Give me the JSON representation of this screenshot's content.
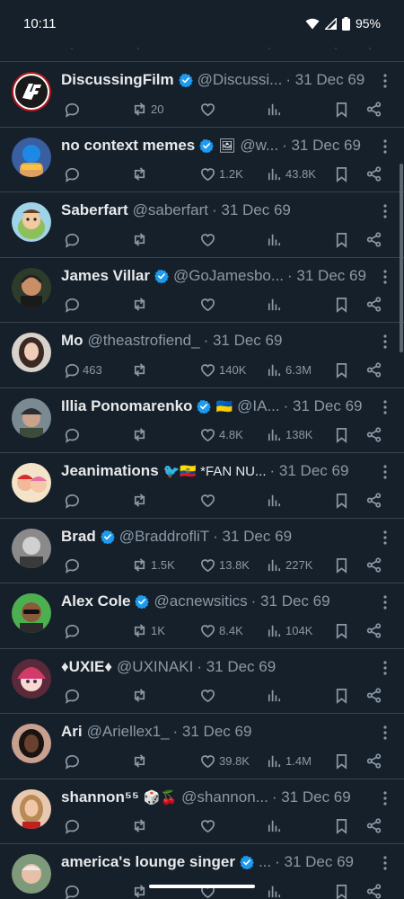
{
  "status_bar": {
    "time": "10:11",
    "battery": "95%"
  },
  "icons": {
    "reply": "reply-icon",
    "retweet": "retweet-icon",
    "like": "like-icon",
    "views": "views-icon",
    "bookmark": "bookmark-icon",
    "share": "share-icon",
    "more": "more-icon",
    "verified": "verified-badge-icon"
  },
  "colors": {
    "background": "#15202b",
    "divider": "#38444d",
    "verified": "#1d9bf0",
    "secondary_text": "#8b98a5"
  },
  "tweets": [
    {
      "name": "DiscussingFilm",
      "verified": true,
      "handle": "@Discussi...",
      "date": "· 31 Dec 69",
      "replies": "",
      "retweets": "20",
      "likes": "",
      "views": "",
      "avatar": "df-logo"
    },
    {
      "name": "no context memes",
      "verified": true,
      "extra": "🖼",
      "handle": "@w...",
      "date": "· 31 Dec 69",
      "replies": "",
      "retweets": "",
      "likes": "1.2K",
      "views": "43.8K",
      "avatar": "wrestler"
    },
    {
      "name": "Saberfart",
      "verified": false,
      "handle": "@saberfart",
      "date": "· 31 Dec 69",
      "replies": "",
      "retweets": "",
      "likes": "",
      "views": "",
      "avatar": "cartoon"
    },
    {
      "name": "James Villar",
      "verified": true,
      "handle": "@GoJamesbo...",
      "date": "· 31 Dec 69",
      "replies": "",
      "retweets": "",
      "likes": "",
      "views": "",
      "avatar": "man-headset"
    },
    {
      "name": "Mo",
      "verified": false,
      "handle": "@theastrofiend_",
      "date": "· 31 Dec 69",
      "replies": "463",
      "retweets": "",
      "likes": "140K",
      "views": "6.3M",
      "avatar": "woman-dark-hair"
    },
    {
      "name": "Illia Ponomarenko",
      "verified": true,
      "extra": "🇺🇦",
      "handle": "@IA...",
      "date": "· 31 Dec 69",
      "replies": "",
      "retweets": "",
      "likes": "4.8K",
      "views": "138K",
      "avatar": "man-cap"
    },
    {
      "name": "Jeanimations",
      "verified": false,
      "extra": "🐦🇪🇨 *FAN NU...",
      "handle": "",
      "date": "· 31 Dec 69",
      "replies": "",
      "retweets": "",
      "likes": "",
      "views": "",
      "avatar": "animated-kids"
    },
    {
      "name": "Brad",
      "verified": true,
      "handle": "@BraddrofliT",
      "date": "· 31 Dec 69",
      "replies": "",
      "retweets": "1.5K",
      "likes": "13.8K",
      "views": "227K",
      "avatar": "man-grayscale"
    },
    {
      "name": "Alex Cole",
      "verified": true,
      "handle": "@acnewsitics",
      "date": "· 31 Dec 69",
      "replies": "",
      "retweets": "1K",
      "likes": "8.4K",
      "views": "104K",
      "avatar": "man-sunglasses"
    },
    {
      "name": "♦UXIE♦",
      "verified": false,
      "handle": "@UXINAKI",
      "date": "· 31 Dec 69",
      "replies": "",
      "retweets": "",
      "likes": "",
      "views": "",
      "avatar": "anime-girl"
    },
    {
      "name": "Ari",
      "verified": false,
      "handle": "@Ariellex1_",
      "date": "· 31 Dec 69",
      "replies": "",
      "retweets": "",
      "likes": "39.8K",
      "views": "1.4M",
      "avatar": "woman-selfie"
    },
    {
      "name": "shannon⁵⁵",
      "verified": false,
      "extra": "🎲🍒",
      "handle": "@shannon...",
      "date": "· 31 Dec 69",
      "replies": "",
      "retweets": "",
      "likes": "",
      "views": "",
      "avatar": "woman-blonde"
    },
    {
      "name": "america's lounge singer",
      "verified": true,
      "handle": "...",
      "date": "· 31 Dec 69",
      "replies": "",
      "retweets": "",
      "likes": "",
      "views": "",
      "avatar": "older-man"
    }
  ]
}
